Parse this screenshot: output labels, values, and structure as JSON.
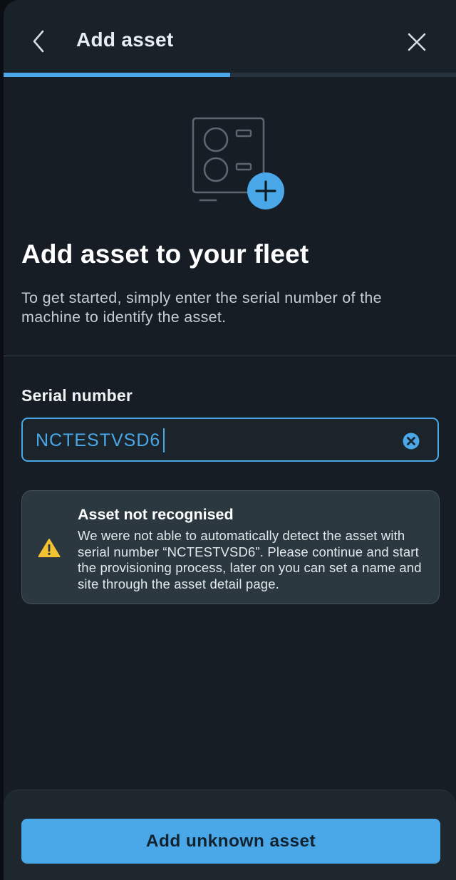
{
  "header": {
    "title": "Add asset",
    "back_icon": "chevron-left-icon",
    "close_icon": "close-icon"
  },
  "progress": {
    "fraction": 0.5
  },
  "hero": {
    "icon": "machine-add-icon"
  },
  "content": {
    "title": "Add asset to your fleet",
    "intro": "To get started, simply enter the serial number of the machine to identify the asset."
  },
  "serial_field": {
    "label": "Serial number",
    "value": "NCTESTVSD6",
    "clear_icon": "clear-icon"
  },
  "alert": {
    "icon": "warning-icon",
    "title": "Asset not recognised",
    "body": "We were not able to automatically detect the asset with serial number “NCTESTVSD6”. Please continue and start the provisioning process, later on you can set a name and site through the asset detail page."
  },
  "footer": {
    "primary_label": "Add unknown asset"
  },
  "colors": {
    "accent": "#4aa8e8",
    "background": "#161d24",
    "warning": "#f2c230"
  }
}
